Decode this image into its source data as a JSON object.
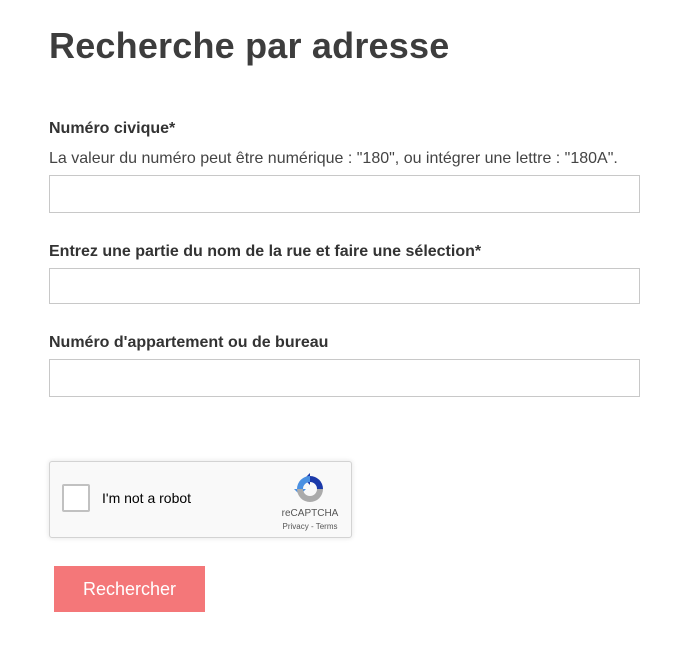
{
  "page": {
    "title": "Recherche par adresse"
  },
  "form": {
    "civic_number": {
      "label": "Numéro civique*",
      "help": "La valeur du numéro peut être numérique : \"180\", ou intégrer une lettre : \"180A\".",
      "value": "",
      "placeholder": ""
    },
    "street": {
      "label": "Entrez une partie du nom de la rue et faire une sélection*",
      "value": "",
      "placeholder": ""
    },
    "apartment": {
      "label": "Numéro d'appartement ou de bureau",
      "value": "",
      "placeholder": ""
    },
    "submit_label": "Rechercher",
    "submit_color": "#f47779"
  },
  "recaptcha": {
    "label": "I'm not a robot",
    "brand": "reCAPTCHA",
    "privacy": "Privacy",
    "separator": " - ",
    "terms": "Terms",
    "checked": false,
    "icon": "recaptcha-logo"
  }
}
